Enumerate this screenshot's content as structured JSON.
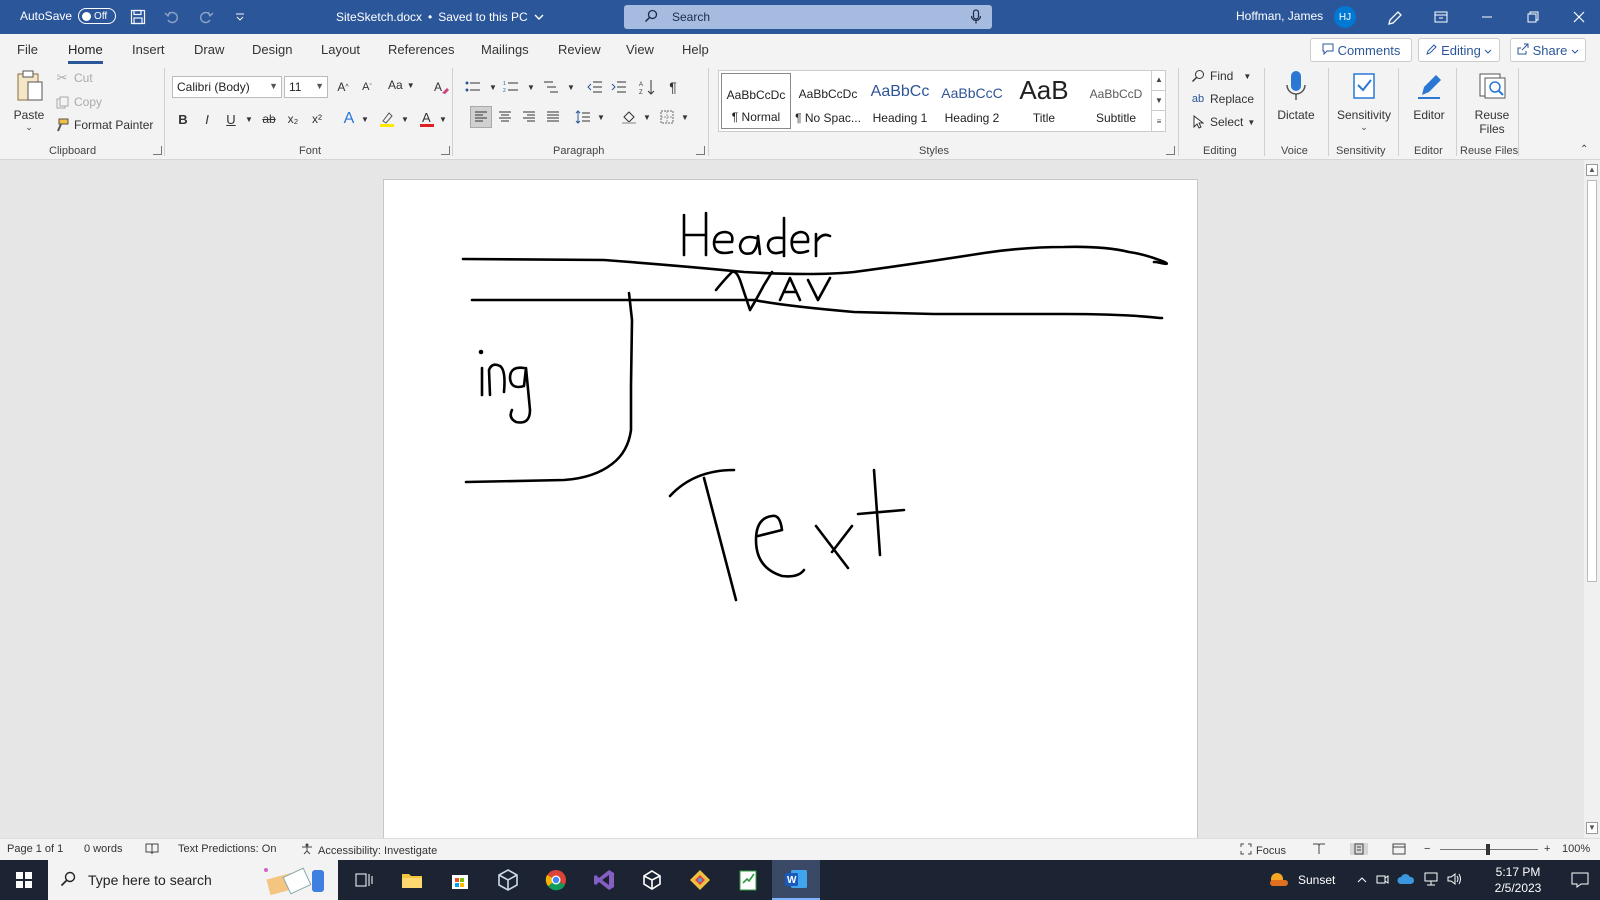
{
  "titlebar": {
    "autosave_label": "AutoSave",
    "autosave_state": "Off",
    "doc_name": "SiteSketch.docx",
    "save_status": "Saved to this PC",
    "search_placeholder": "Search",
    "user_name": "Hoffman, James",
    "user_initials": "HJ"
  },
  "menu": {
    "tabs": [
      "File",
      "Home",
      "Insert",
      "Draw",
      "Design",
      "Layout",
      "References",
      "Mailings",
      "Review",
      "View",
      "Help"
    ],
    "active_tab": "Home",
    "comments": "Comments",
    "editing": "Editing",
    "share": "Share"
  },
  "ribbon": {
    "clipboard": {
      "paste": "Paste",
      "cut": "Cut",
      "copy": "Copy",
      "format_painter": "Format Painter",
      "label": "Clipboard"
    },
    "font": {
      "font_name": "Calibri (Body)",
      "font_size": "11",
      "change_case": "Aa",
      "bold": "B",
      "italic": "I",
      "underline": "U",
      "strike": "ab",
      "subscript": "x₂",
      "superscript": "x²",
      "label": "Font"
    },
    "paragraph": {
      "label": "Paragraph"
    },
    "styles": {
      "label": "Styles",
      "items": [
        {
          "sample": "AaBbCcDc",
          "name": "¶ Normal"
        },
        {
          "sample": "AaBbCcDc",
          "name": "¶ No Spac..."
        },
        {
          "sample": "AaBbCc",
          "name": "Heading 1"
        },
        {
          "sample": "AaBbCcC",
          "name": "Heading 2"
        },
        {
          "sample": "AaB",
          "name": "Title"
        },
        {
          "sample": "AaBbCcD",
          "name": "Subtitle"
        }
      ]
    },
    "editing": {
      "find": "Find",
      "replace": "Replace",
      "select": "Select",
      "label": "Editing"
    },
    "voice": {
      "dictate": "Dictate",
      "label": "Voice"
    },
    "sensitivity": {
      "button": "Sensitivity",
      "label": "Sensitivity"
    },
    "editor": {
      "button": "Editor",
      "label": "Editor"
    },
    "reuse": {
      "button_line1": "Reuse",
      "button_line2": "Files",
      "label": "Reuse Files"
    }
  },
  "document": {
    "ink_words": [
      "Header",
      "NAV",
      "ing",
      "Text"
    ]
  },
  "statusbar": {
    "page": "Page 1 of 1",
    "words": "0 words",
    "text_predictions": "Text Predictions: On",
    "accessibility": "Accessibility: Investigate",
    "focus": "Focus",
    "zoom": "100%"
  },
  "taskbar": {
    "search_placeholder": "Type here to search",
    "weather": "Sunset",
    "time": "5:17 PM",
    "date": "2/5/2023"
  },
  "colors": {
    "title_bar": "#2b579a",
    "ribbon_bg": "#f3f3f3",
    "canvas_bg": "#e6e6e6",
    "taskbar_bg": "#1c2433",
    "accent": "#2b579a"
  }
}
